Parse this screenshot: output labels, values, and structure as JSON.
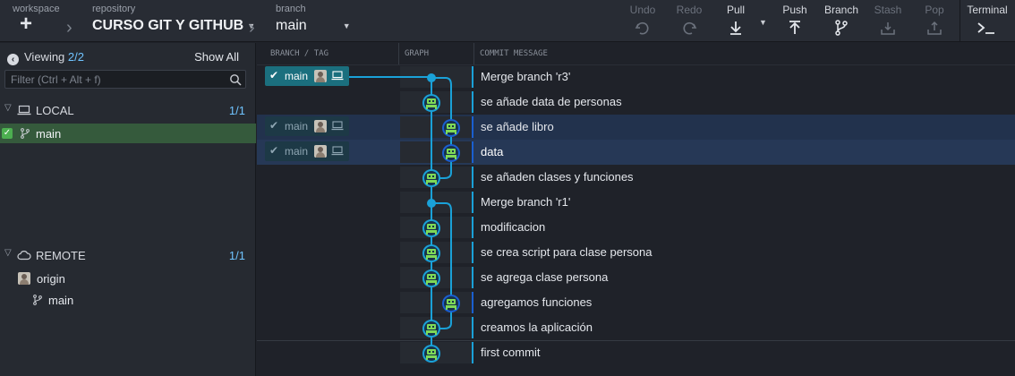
{
  "toolbar": {
    "workspace_label": "workspace",
    "repository_label": "repository",
    "repository_name": "CURSO GIT Y GITHUB",
    "branch_label": "branch",
    "branch_name": "main",
    "buttons": [
      {
        "label": "Undo",
        "icon": "undo-icon",
        "enabled": false
      },
      {
        "label": "Redo",
        "icon": "redo-icon",
        "enabled": false
      },
      {
        "label": "Pull",
        "icon": "pull-icon",
        "enabled": true
      },
      {
        "label": "Push",
        "icon": "push-icon",
        "enabled": true
      },
      {
        "label": "Branch",
        "icon": "branch-icon",
        "enabled": true
      },
      {
        "label": "Stash",
        "icon": "stash-icon",
        "enabled": false
      },
      {
        "label": "Pop",
        "icon": "pop-icon",
        "enabled": false
      },
      {
        "label": "Terminal",
        "icon": "terminal-icon",
        "enabled": true
      }
    ]
  },
  "sidebar": {
    "viewing_label": "Viewing",
    "viewing_count": "2/2",
    "show_all": "Show All",
    "filter_placeholder": "Filter (Ctrl + Alt + f)",
    "local": {
      "title": "LOCAL",
      "count": "1/1",
      "branches": [
        "main"
      ]
    },
    "remote": {
      "title": "REMOTE",
      "count": "1/1",
      "remotes": [
        {
          "name": "origin",
          "branches": [
            "main"
          ]
        }
      ]
    }
  },
  "graph": {
    "columns": {
      "branch_tag": "BRANCH / TAG",
      "graph": "GRAPH",
      "commit_message": "COMMIT MESSAGE"
    },
    "commits": [
      {
        "message": "Merge branch 'r3'",
        "tag": "main",
        "tag_style": "head",
        "lane": 0,
        "merge": true,
        "selected": false
      },
      {
        "message": "se añade data de personas",
        "tag": "",
        "lane": 0,
        "merge": false,
        "selected": false
      },
      {
        "message": "se añade libro",
        "tag": "main",
        "tag_style": "plain",
        "lane": 1,
        "merge": false,
        "selected": "light"
      },
      {
        "message": "data",
        "tag": "main",
        "tag_style": "plain",
        "lane": 1,
        "merge": false,
        "selected": "strong"
      },
      {
        "message": "se añaden clases y funciones",
        "tag": "",
        "lane": 0,
        "merge": false,
        "selected": false
      },
      {
        "message": "Merge branch 'r1'",
        "tag": "",
        "lane": 0,
        "merge": true,
        "selected": false
      },
      {
        "message": "modificacion",
        "tag": "",
        "lane": 0,
        "merge": false,
        "selected": false
      },
      {
        "message": "se crea script para clase persona",
        "tag": "",
        "lane": 0,
        "merge": false,
        "selected": false
      },
      {
        "message": "se agrega clase persona",
        "tag": "",
        "lane": 0,
        "merge": false,
        "selected": false
      },
      {
        "message": "agregamos funciones",
        "tag": "",
        "lane": 1,
        "merge": false,
        "selected": false
      },
      {
        "message": "creamos la aplicación",
        "tag": "",
        "lane": 0,
        "merge": false,
        "selected": false
      },
      {
        "message": "first commit",
        "tag": "",
        "lane": 0,
        "merge": false,
        "selected": false
      }
    ]
  },
  "colors": {
    "lane0": "#1aa1d8",
    "lane1": "#1a5fd0",
    "accent": "#6fc3ff",
    "avatar_green": "#7ed957"
  }
}
